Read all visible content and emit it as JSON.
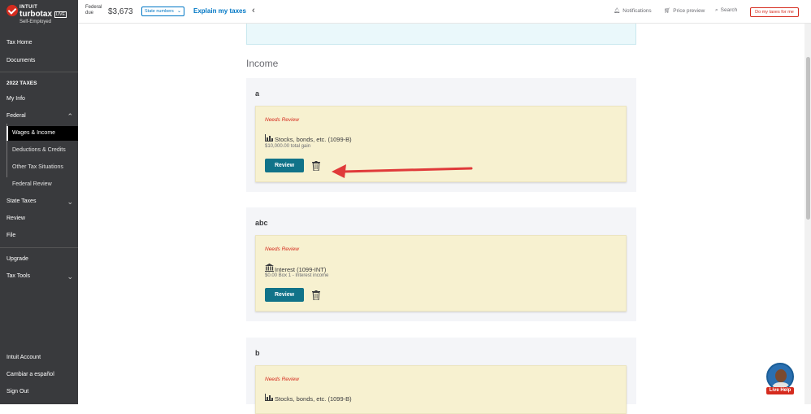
{
  "app": {
    "brand_intuit": "INTUIT",
    "brand_product": "turbotax",
    "brand_badge": "LIVE",
    "brand_edition": "Self-Employed"
  },
  "sidebar": {
    "items": [
      {
        "label": "Tax Home"
      },
      {
        "label": "Documents"
      },
      {
        "label": "2022 TAXES"
      },
      {
        "label": "My Info"
      },
      {
        "label": "Federal"
      },
      {
        "label": "Wages & Income"
      },
      {
        "label": "Deductions & Credits"
      },
      {
        "label": "Other Tax Situations"
      },
      {
        "label": "Federal Review"
      },
      {
        "label": "State Taxes"
      },
      {
        "label": "Review"
      },
      {
        "label": "File"
      },
      {
        "label": "Upgrade"
      },
      {
        "label": "Tax Tools"
      }
    ],
    "footer": [
      {
        "label": "Intuit Account"
      },
      {
        "label": "Cambiar a español"
      },
      {
        "label": "Sign Out"
      }
    ],
    "active_item": "Wages & Income"
  },
  "topbar": {
    "federal_label": "Federal due",
    "federal_amount": "$3,673",
    "state_select": "State numbers",
    "explain_link": "Explain my taxes",
    "notifications": "Notifications",
    "price_preview": "Price preview",
    "search": "Search",
    "do_my_taxes": "Do my taxes for me"
  },
  "main": {
    "section_title": "Income",
    "groups": [
      {
        "title": "a",
        "status": "Needs Review",
        "item_title": "Stocks, bonds, etc. (1099-B)",
        "item_sub": "$10,000.00 total gain",
        "icon": "chart-icon",
        "button": "Review"
      },
      {
        "title": "abc",
        "status": "Needs Review",
        "item_title": "Interest (1099-INT)",
        "item_sub": "$0.00 Box 1 - Interest income",
        "icon": "bank-icon",
        "button": "Review"
      },
      {
        "title": "b",
        "status": "Needs Review",
        "item_title": "Stocks, bonds, etc. (1099-B)",
        "item_sub": "",
        "icon": "chart-icon",
        "button": "Review"
      }
    ]
  },
  "live_help": {
    "label": "Live Help"
  },
  "colors": {
    "sidebar_bg": "#393a3d",
    "review_button": "#117389",
    "needs_review": "#d52b1e",
    "card_bg": "#f7f1d0",
    "link": "#0077c5",
    "annotation_arrow": "#e03a3a"
  }
}
